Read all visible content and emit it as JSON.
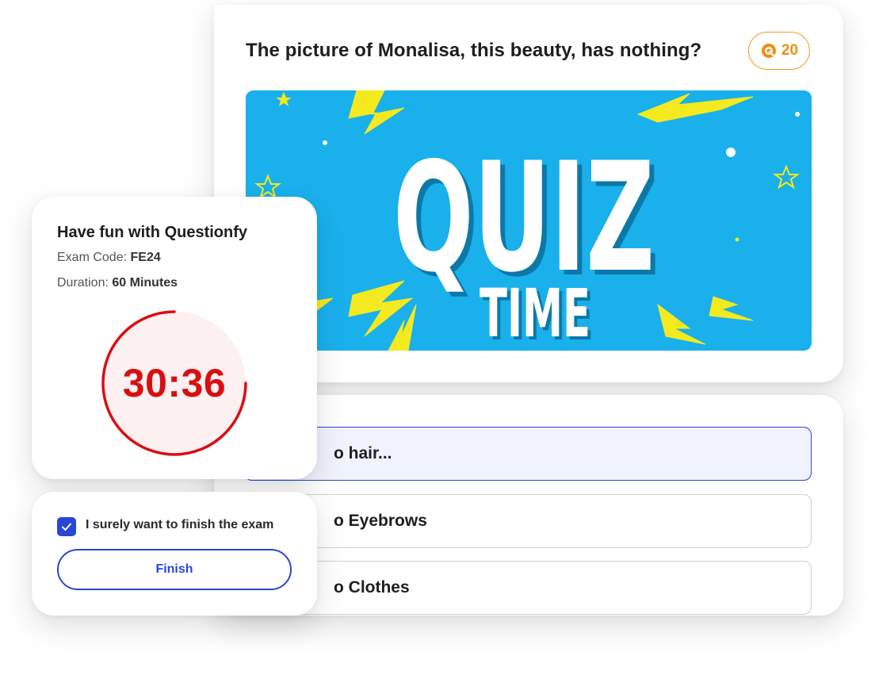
{
  "question": {
    "text": "The picture of Monalisa, this beauty, has nothing?",
    "points": "20",
    "points_icon": "coin-q-icon",
    "banner": {
      "line1": "QUIZ",
      "line2": "TIME"
    }
  },
  "answers": [
    {
      "label": "o hair...",
      "selected": true
    },
    {
      "label": "o Eyebrows",
      "selected": false
    },
    {
      "label": "o Clothes",
      "selected": false
    }
  ],
  "exam": {
    "title": "Have fun with Questionfy",
    "code_label": "Exam Code:",
    "code_value": "FE24",
    "duration_label": "Duration:",
    "duration_value": "60 Minutes",
    "timer": "30:36"
  },
  "finish": {
    "confirm_label": "I surely want to finish the exam",
    "confirm_checked": true,
    "button_label": "Finish"
  },
  "colors": {
    "accent": "#2a46d6",
    "timer_red": "#d80f12",
    "points_orange": "#f08f10",
    "banner_blue": "#19b0ec",
    "lightning_yellow": "#f4ea1f"
  }
}
